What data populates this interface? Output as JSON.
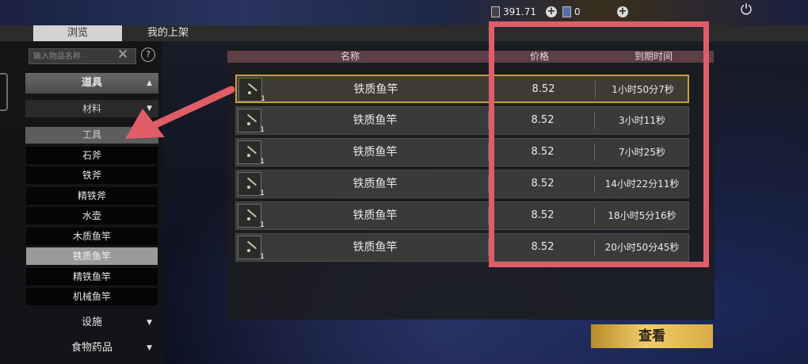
{
  "currency": {
    "amount": "391.71",
    "ticket_count": "0",
    "add_icon": "+"
  },
  "power_icon": "⏻",
  "tabs": [
    {
      "label": "浏览"
    },
    {
      "label": "我的上架"
    }
  ],
  "search": {
    "placeholder": "输入物品名称",
    "clear_icon": "✕",
    "help_icon": "?"
  },
  "categories": {
    "tools_group": {
      "label": "道具",
      "arrow": "▲"
    },
    "materials": {
      "label": "材料",
      "arrow": "▼"
    },
    "tools": {
      "label": "工具"
    },
    "tool_items": [
      {
        "label": "石斧"
      },
      {
        "label": "铁斧"
      },
      {
        "label": "精铁斧"
      },
      {
        "label": "水壶"
      },
      {
        "label": "木质鱼竿"
      },
      {
        "label": "铁质鱼竿"
      },
      {
        "label": "精铁鱼竿"
      },
      {
        "label": "机械鱼竿"
      }
    ],
    "facilities": {
      "label": "设施",
      "arrow": "▼"
    },
    "food_medicine": {
      "label": "食物药品",
      "arrow": "▼"
    }
  },
  "table": {
    "headers": {
      "name": "名称",
      "price": "价格",
      "expire": "到期时间"
    },
    "rows": [
      {
        "name": "铁质鱼竿",
        "qty": "1",
        "price": "8.52",
        "expire": "1小时50分7秒"
      },
      {
        "name": "铁质鱼竿",
        "qty": "1",
        "price": "8.52",
        "expire": "3小时11秒"
      },
      {
        "name": "铁质鱼竿",
        "qty": "1",
        "price": "8.52",
        "expire": "7小时25秒"
      },
      {
        "name": "铁质鱼竿",
        "qty": "1",
        "price": "8.52",
        "expire": "14小时22分11秒"
      },
      {
        "name": "铁质鱼竿",
        "qty": "1",
        "price": "8.52",
        "expire": "18小时5分16秒"
      },
      {
        "name": "铁质鱼竿",
        "qty": "1",
        "price": "8.52",
        "expire": "20小时50分45秒"
      }
    ]
  },
  "view_button": {
    "label": "查看"
  },
  "colors": {
    "highlight": "#e05d68",
    "selected_border": "#c99c3b",
    "button_gold": "#e0b84f"
  }
}
